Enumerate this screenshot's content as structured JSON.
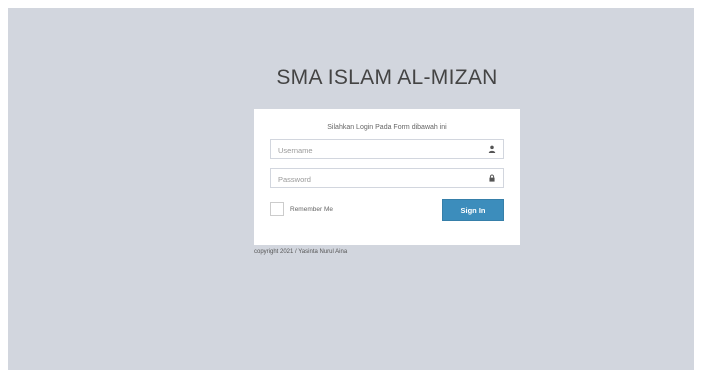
{
  "login": {
    "logo_text": "SMA ISLAM AL-MIZAN",
    "message": "Silahkan Login Pada Form dibawah ini",
    "username_placeholder": "Username",
    "password_placeholder": "Password",
    "username_icon": "user-icon",
    "password_icon": "lock-icon",
    "remember_label": "Remember Me",
    "signin_label": "Sign In",
    "footer": "copyright 2021 / Yasinta Nurul Aina"
  },
  "colors": {
    "background": "#d2d6de",
    "primary_button": "#3c8dbc"
  }
}
